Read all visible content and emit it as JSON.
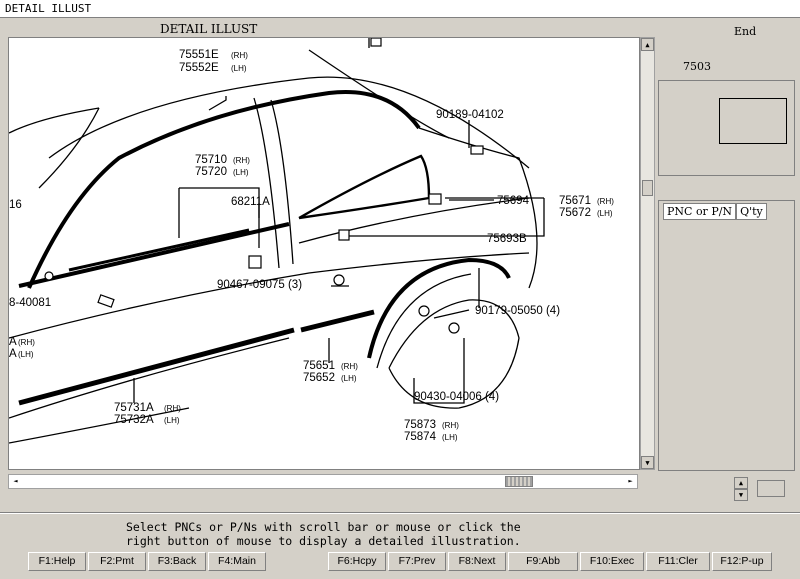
{
  "window": {
    "title": "DETAIL ILLUST"
  },
  "illustration": {
    "heading": "DETAIL ILLUST",
    "callouts": {
      "c1_a": "75551E",
      "c1_a_sfx": "(RH)",
      "c1_b": "75552E",
      "c1_b_sfx": "(LH)",
      "c2": "90189-04102",
      "c3_a": "75710",
      "c3_a_sfx": "(RH)",
      "c3_b": "75720",
      "c3_b_sfx": "(LH)",
      "c4": "68211A",
      "c5": "75694",
      "c6_a": "75671",
      "c6_a_sfx": "(RH)",
      "c6_b": "75672",
      "c6_b_sfx": "(LH)",
      "c7": "75693B",
      "c8": "90467-09075 (3)",
      "c9": "90179-05050 (4)",
      "c10_a": "75651",
      "c10_a_sfx": "(RH)",
      "c10_b": "75652",
      "c10_b_sfx": "(LH)",
      "c11_a": "75731A",
      "c11_a_sfx": "(RH)",
      "c11_b": "75732A",
      "c11_b_sfx": "(LH)",
      "c12": "90430-04006 (4)",
      "c13_a": "75873",
      "c13_a_sfx": "(RH)",
      "c13_b": "75874",
      "c13_b_sfx": "(LH)",
      "edge_16": "16",
      "edge_40081": "8-40081",
      "edge_a_rh": "A",
      "edge_a_rh_sfx": "(RH)",
      "edge_a_lh": "A",
      "edge_a_lh_sfx": "(LH)"
    }
  },
  "side_panel": {
    "end_label": "End",
    "pnc_code": "7503",
    "list_headers": [
      "PNC or P/N",
      "Q'ty"
    ]
  },
  "status": {
    "message_line1": "Select PNCs or P/Ns with scroll bar or mouse or click the",
    "message_line2": "right button of mouse to display a detailed illustration."
  },
  "function_keys": [
    "F1:Help",
    "F2:Pmt",
    "F3:Back",
    "F4:Main",
    "F6:Hcpy",
    "F7:Prev",
    "F8:Next",
    "F9:Abb",
    "F10:Exec",
    "F11:Cler",
    "F12:P-up"
  ],
  "scroll_arrows": {
    "up": "▲",
    "down": "▼",
    "left": "◄",
    "right": "►"
  }
}
